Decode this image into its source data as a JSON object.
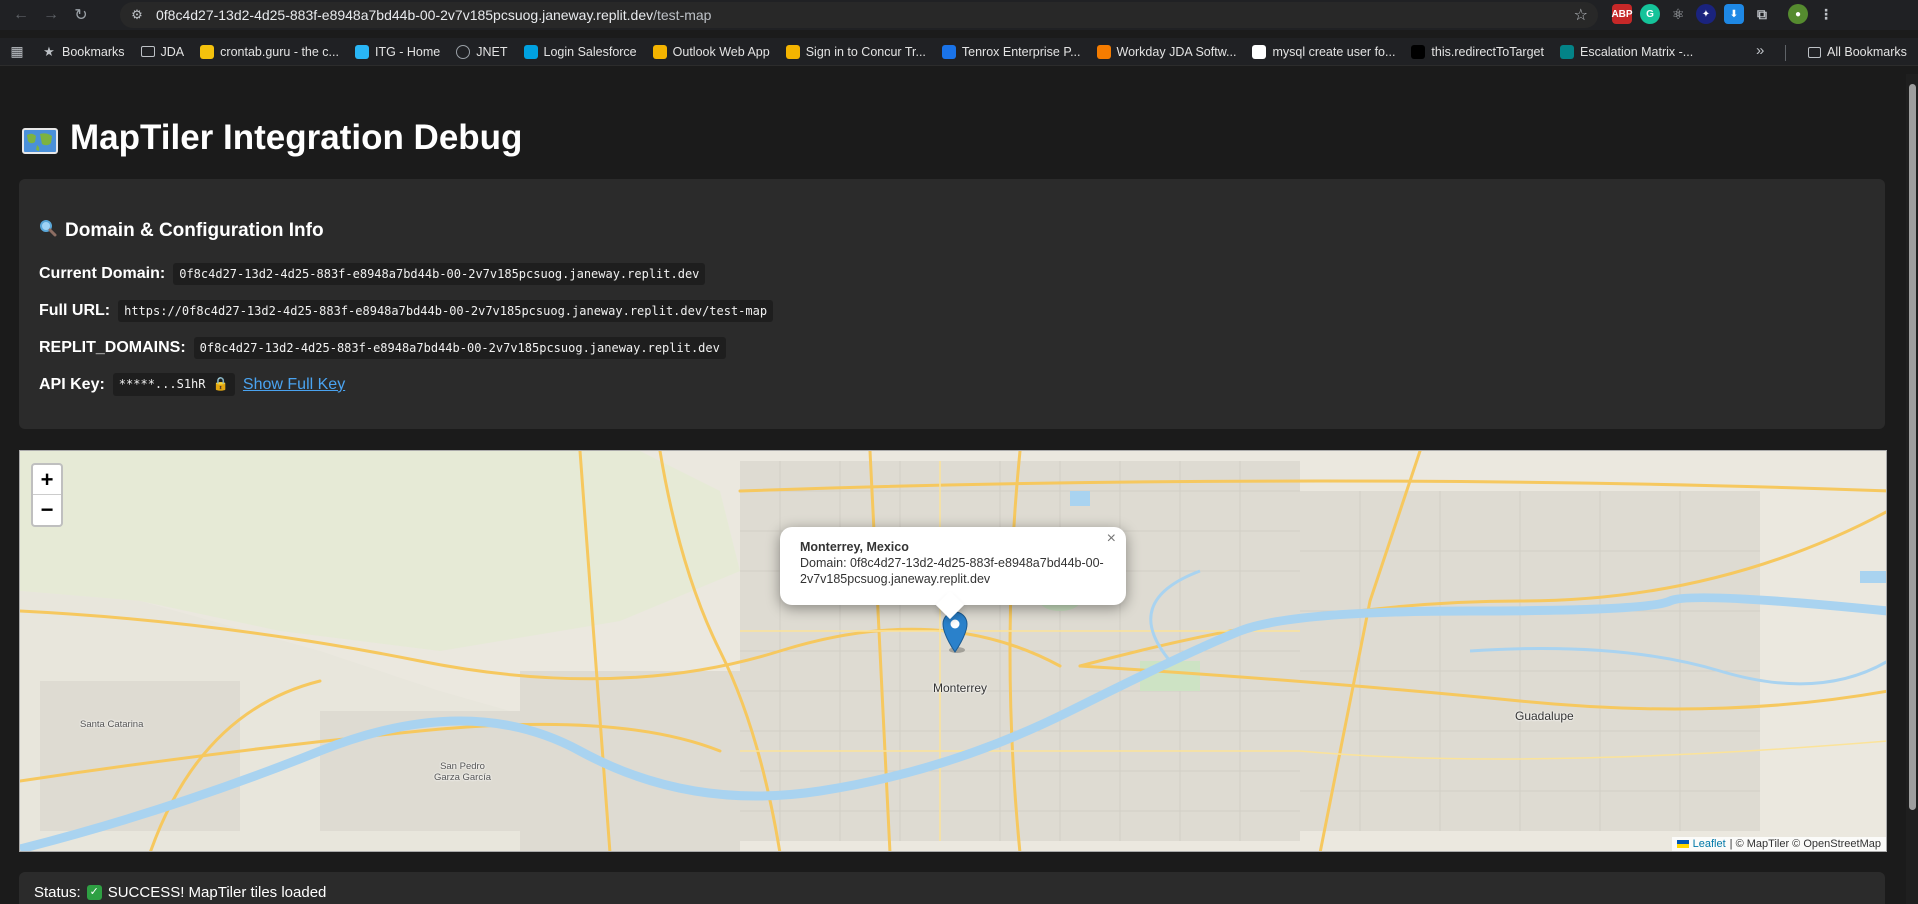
{
  "browser": {
    "url_host": "0f8c4d27-13d2-4d25-883f-e8948a7bd44b-00-2v7v185pcsuog.janeway.replit.dev",
    "url_path": "/test-map",
    "extensions": [
      "ABP",
      "G"
    ]
  },
  "bookmarks": {
    "items": [
      {
        "label": "Bookmarks",
        "icon": "star-icon",
        "color": "#bdc1c6"
      },
      {
        "label": "JDA",
        "icon": "folder-icon",
        "color": "#bdc1c6"
      },
      {
        "label": "crontab.guru - the c...",
        "icon": "crontab-icon",
        "color": "#f4c20d"
      },
      {
        "label": "ITG - Home",
        "icon": "itg-icon",
        "color": "#29b6f6"
      },
      {
        "label": "JNET",
        "icon": "globe-icon",
        "color": "#9aa0a6"
      },
      {
        "label": "Login  Salesforce",
        "icon": "salesforce-icon",
        "color": "#00a1e0"
      },
      {
        "label": "Outlook Web App",
        "icon": "outlook-icon",
        "color": "#f4b400"
      },
      {
        "label": "Sign in to Concur Tr...",
        "icon": "concur-icon",
        "color": "#f4b400"
      },
      {
        "label": "Tenrox Enterprise P...",
        "icon": "tenrox-icon",
        "color": "#1a73e8"
      },
      {
        "label": "Workday JDA Softw...",
        "icon": "workday-icon",
        "color": "#f57c00"
      },
      {
        "label": "mysql create user fo...",
        "icon": "google-icon",
        "color": "#ffffff"
      },
      {
        "label": "this.redirectToTarget",
        "icon": "medium-icon",
        "color": "#000000"
      },
      {
        "label": "Escalation Matrix -...",
        "icon": "sharepoint-icon",
        "color": "#038387"
      }
    ],
    "all_label": "All Bookmarks"
  },
  "page": {
    "title": "MapTiler Integration Debug",
    "card_title": "Domain & Configuration Info",
    "current_domain_label": "Current Domain:",
    "current_domain_value": "0f8c4d27-13d2-4d25-883f-e8948a7bd44b-00-2v7v185pcsuog.janeway.replit.dev",
    "full_url_label": "Full URL:",
    "full_url_value": "https://0f8c4d27-13d2-4d25-883f-e8948a7bd44b-00-2v7v185pcsuog.janeway.replit.dev/test-map",
    "replit_domains_label": "REPLIT_DOMAINS:",
    "replit_domains_value": "0f8c4d27-13d2-4d25-883f-e8948a7bd44b-00-2v7v185pcsuog.janeway.replit.dev",
    "api_key_label": "API Key:",
    "api_key_value": "*****...S1hR",
    "show_key_label": "Show Full Key"
  },
  "map": {
    "zoom_in": "+",
    "zoom_out": "−",
    "popup_title": "Monterrey, Mexico",
    "popup_body": "Domain: 0f8c4d27-13d2-4d25-883f-e8948a7bd44b-00-2v7v185pcsuog.janeway.replit.dev",
    "popup_close": "×",
    "labels": {
      "monterrey": "Monterrey",
      "guadalupe": "Guadalupe",
      "santa_catarina": "Santa Catarina",
      "san_pedro": "San Pedro\nGarza García"
    },
    "attribution_leaflet": "Leaflet",
    "attribution_rest": "| © MapTiler © OpenStreetMap",
    "river_color": "#a9d3f0",
    "road_color": "#f6c85f"
  },
  "status": {
    "label": "Status:",
    "text": "SUCCESS! MapTiler tiles loaded"
  }
}
